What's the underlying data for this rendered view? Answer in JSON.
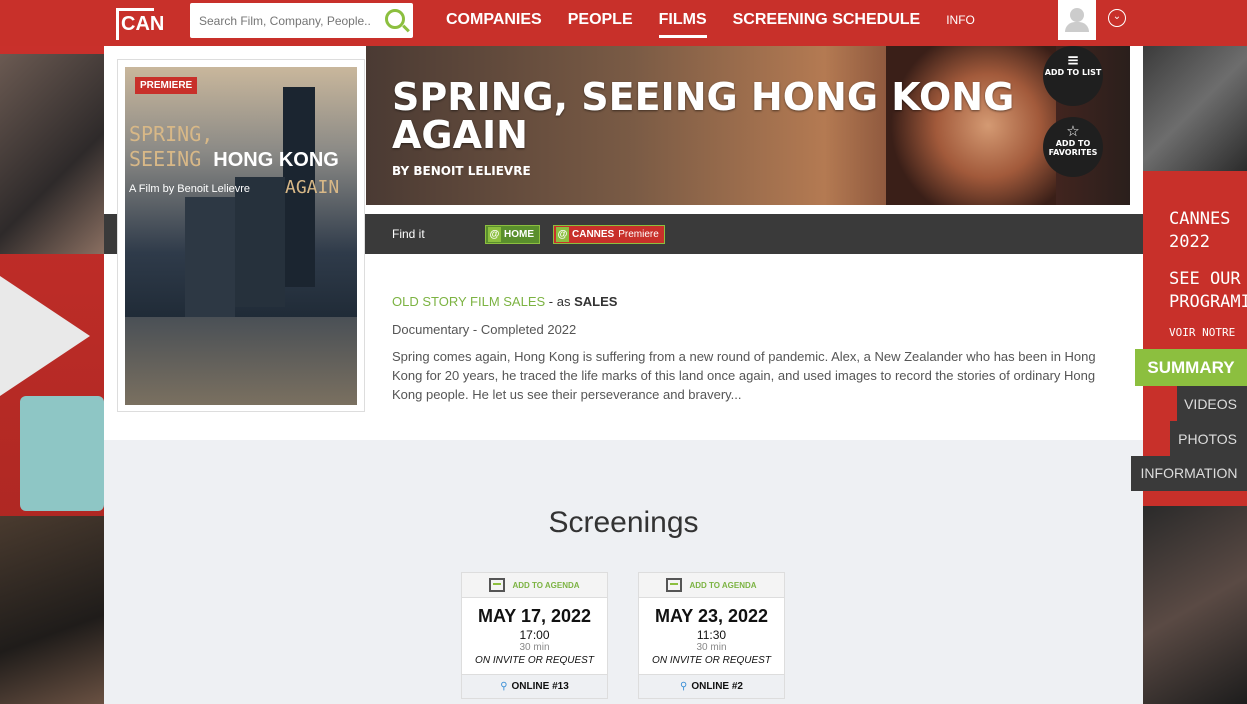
{
  "header": {
    "logo": "CAN",
    "search": {
      "placeholder": "Search Film, Company, People..."
    },
    "nav": [
      "COMPANIES",
      "PEOPLE",
      "FILMS",
      "SCREENING SCHEDULE",
      "INFO"
    ],
    "active_nav": "FILMS"
  },
  "promo": {
    "line1a": "CANNES",
    "line1b": "2022",
    "line2a": "SEE OUR",
    "line2b": "PROGRAMI",
    "line3": "VOIR NOTRE"
  },
  "film": {
    "premiere_badge": "PREMIERE",
    "poster": {
      "line1": "SPRING,",
      "line2a": "SEEING ",
      "line2b": "HONG KONG",
      "byline": "A Film by Benoit Lelievre",
      "again": "AGAIN"
    },
    "title": "SPRING, SEEING HONG KONG AGAIN",
    "director": "BY BENOIT LELIEVRE",
    "add_to_list": "ADD TO LIST",
    "add_to_favorites": "ADD TO FAVORITES"
  },
  "find_it": {
    "label": "Find it",
    "home": "HOME",
    "cannes": "CANNES",
    "cannes_sub": "Premiere"
  },
  "details": {
    "company": "OLD STORY FILM SALES",
    "as": " - as ",
    "role": "SALES",
    "genre": "Documentary - Completed 2022",
    "synopsis": "Spring comes again, Hong Kong is suffering from a new round of pandemic. Alex, a New Zealander who has been in Hong Kong for 20 years, he traced the life marks of this land once again, and used images to record the stories of ordinary Hong Kong people. He let us see their perseverance and bravery..."
  },
  "screenings": {
    "title": "Screenings",
    "cards": [
      {
        "agenda": "ADD TO AGENDA",
        "date": "MAY 17, 2022",
        "time": "17:00",
        "duration": "30 min",
        "access": "ON INVITE OR REQUEST",
        "location": "ONLINE #13"
      },
      {
        "agenda": "ADD TO AGENDA",
        "date": "MAY 23, 2022",
        "time": "11:30",
        "duration": "30 min",
        "access": "ON INVITE OR REQUEST",
        "location": "ONLINE #2"
      }
    ]
  },
  "side_tabs": [
    "SUMMARY",
    "VIDEOS",
    "PHOTOS",
    "INFORMATION"
  ],
  "colors": {
    "brand_red": "#c8302a",
    "accent_green": "#8cbf3f",
    "dark_bar": "#3a3a3a"
  }
}
